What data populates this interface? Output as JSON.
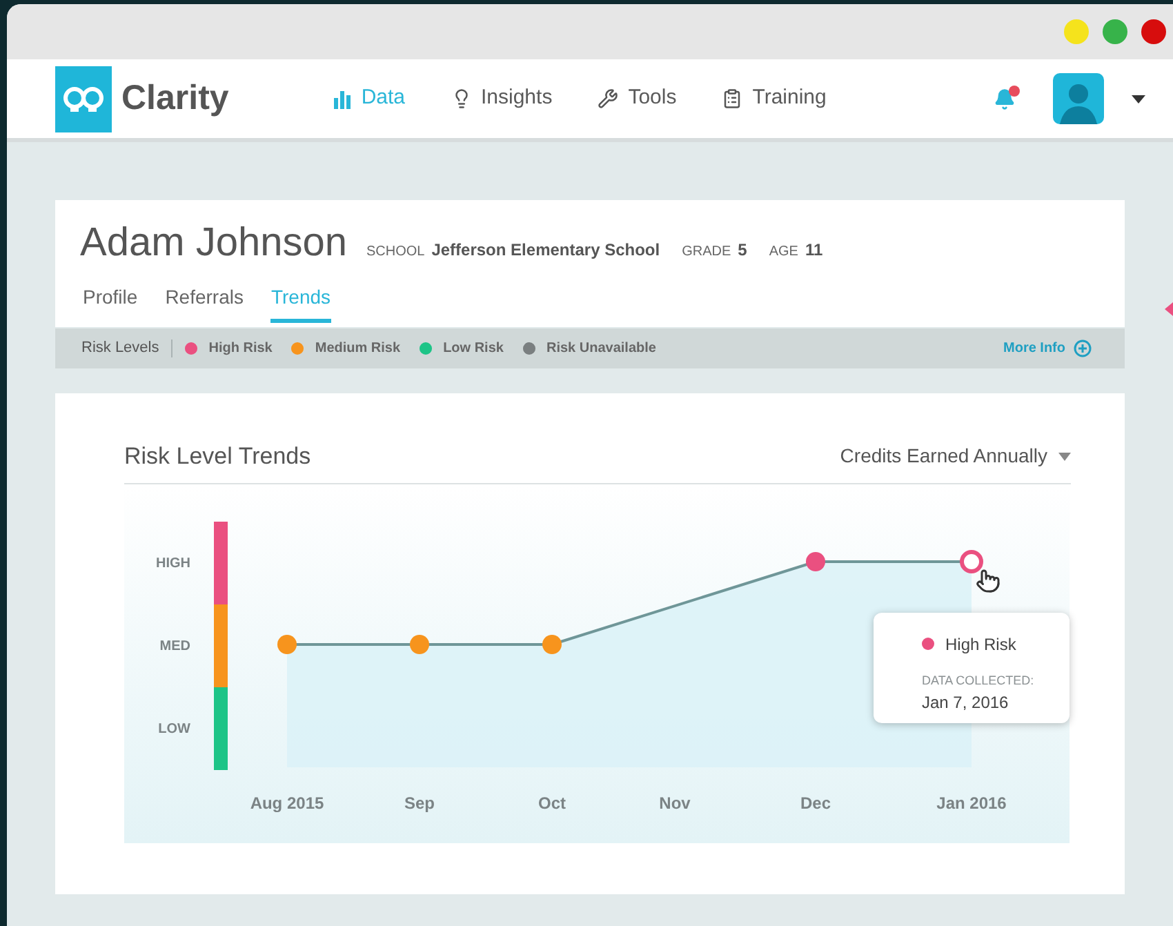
{
  "app": {
    "name": "Clarity"
  },
  "nav": [
    {
      "label": "Data",
      "kind": "bars",
      "selected": true
    },
    {
      "label": "Insights",
      "kind": "bulb",
      "selected": false
    },
    {
      "label": "Tools",
      "kind": "tools",
      "selected": false
    },
    {
      "label": "Training",
      "kind": "clipboard",
      "selected": false
    }
  ],
  "notifications": {
    "unread": true
  },
  "student": {
    "name": "Adam Johnson",
    "fields": [
      {
        "label": "SCHOOL",
        "value": "Jefferson Elementary School"
      },
      {
        "label": "GRADE",
        "value": "5"
      },
      {
        "label": "AGE",
        "value": "11"
      }
    ]
  },
  "tabs": [
    {
      "label": "Profile",
      "selected": false
    },
    {
      "label": "Referrals",
      "selected": false
    },
    {
      "label": "Trends",
      "selected": true
    }
  ],
  "legend": {
    "title": "Risk Levels",
    "items": [
      {
        "label": "High Risk",
        "color": "#ea5080"
      },
      {
        "label": "Medium Risk",
        "color": "#f7941d"
      },
      {
        "label": "Low Risk",
        "color": "#1dc487"
      },
      {
        "label": "Risk Unavailable",
        "color": "#7a7f80"
      }
    ],
    "more_info": "More Info"
  },
  "trends": {
    "title": "Risk Level Trends",
    "metric": "Credits Earned Annually",
    "y_labels": [
      {
        "label": "HIGH",
        "color": "#ea5080"
      },
      {
        "label": "MED",
        "color": "#f7941d"
      },
      {
        "label": "LOW",
        "color": "#1dc487"
      }
    ],
    "points": [
      {
        "label": "Aug 2015",
        "kind": "medium",
        "color": "#f7941d",
        "selected": false
      },
      {
        "label": "Sep",
        "kind": "medium",
        "color": "#f7941d",
        "selected": false
      },
      {
        "label": "Oct",
        "kind": "medium",
        "color": "#f7941d",
        "selected": false
      },
      {
        "label": "Nov",
        "kind": "none",
        "selected": false
      },
      {
        "label": "Dec",
        "kind": "high",
        "color": "#ea5080",
        "selected": false
      },
      {
        "label": "Jan 2016",
        "kind": "high",
        "color": "#ea5080",
        "selected": true
      }
    ],
    "tooltip": {
      "label": "High Risk",
      "color": "#ea5080",
      "caption": "DATA COLLECTED:",
      "date": "Jan 7, 2016"
    }
  }
}
